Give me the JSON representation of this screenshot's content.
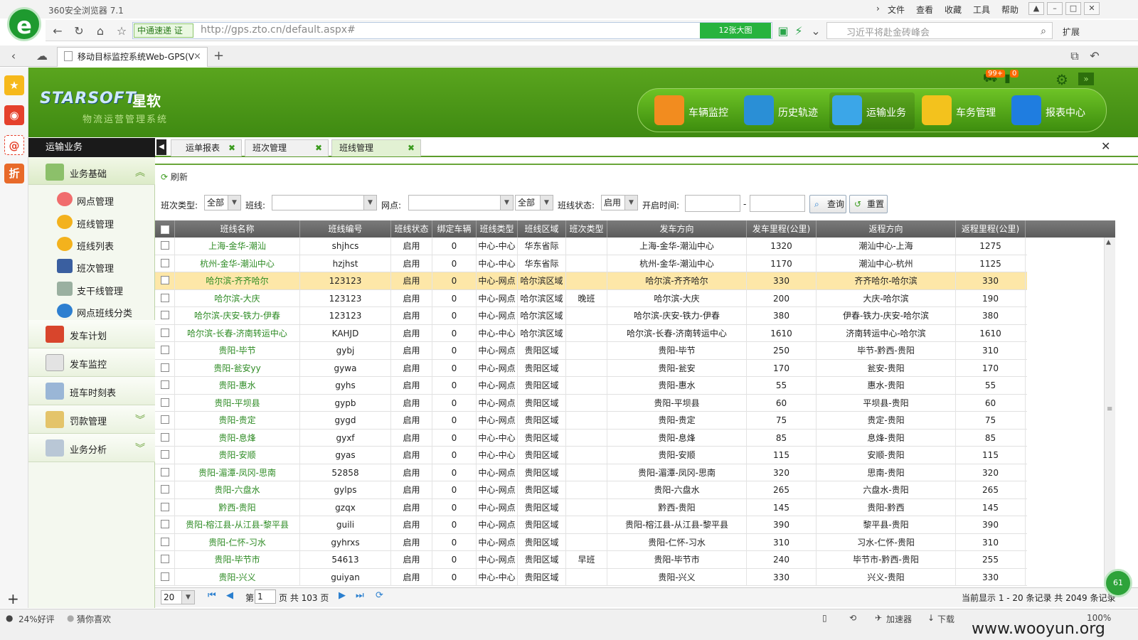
{
  "browser": {
    "title": "360安全浏览器 7.1",
    "menu": [
      "文件",
      "查看",
      "收藏",
      "工具",
      "帮助"
    ],
    "site_badge": "中通速递 证",
    "url": "http://gps.zto.cn/default.aspx#",
    "big_image": "12张大图",
    "search_placeholder": "习近平将赴金砖峰会",
    "extensions_label": "扩展",
    "tab_title": "移动目标监控系统Web-GPS(V",
    "status": {
      "rating": "24%好评",
      "guess": "猜你喜欢",
      "accelerator": "加速器",
      "download": "下载",
      "zoom": "100%"
    }
  },
  "app": {
    "brand": "STARSOFT",
    "brand_cn": "星软",
    "subtitle": "物流运营管理系统",
    "badges": [
      "99+",
      "0"
    ],
    "modules": [
      {
        "label": "车辆监控",
        "color": "#f28c1f"
      },
      {
        "label": "历史轨迹",
        "color": "#2a8fd6"
      },
      {
        "label": "运输业务",
        "color": "#3ba6e8"
      },
      {
        "label": "车务管理",
        "color": "#f3c21d"
      },
      {
        "label": "报表中心",
        "color": "#1f7de0"
      }
    ],
    "active_module": "运输业务"
  },
  "nav": {
    "header": "运输业务",
    "group_basic": "业务基础",
    "sub_items": [
      "网点管理",
      "班线管理",
      "班线列表",
      "班次管理",
      "支干线管理",
      "网点班线分类"
    ],
    "groups": [
      "发车计划",
      "发车监控",
      "班车时刻表",
      "罚款管理",
      "业务分析"
    ]
  },
  "tabs": [
    "运单报表",
    "班次管理",
    "班线管理"
  ],
  "toolbar": {
    "refresh": "刷新"
  },
  "filters": {
    "shift_type_label": "班次类型:",
    "shift_type_value": "全部",
    "line_label": "班线:",
    "line_value": "",
    "site_label": "网点:",
    "site_value": "",
    "site_scope": "全部",
    "status_label": "班线状态:",
    "status_value": "启用",
    "start_label": "开启时间:",
    "start_from": "",
    "start_to": "",
    "dash": "-",
    "query": "查询",
    "reset": "重置"
  },
  "grid": {
    "columns": [
      "班线名称",
      "班线编号",
      "班线状态",
      "绑定车辆",
      "班线类型",
      "班线区域",
      "班次类型",
      "发车方向",
      "发车里程(公里)",
      "返程方向",
      "返程里程(公里)"
    ],
    "rows": [
      [
        "上海-金华-潮汕",
        "shjhcs",
        "启用",
        "0",
        "中心-中心",
        "华东省际",
        "",
        "上海-金华-潮汕中心",
        "1320",
        "潮汕中心-上海",
        "1275"
      ],
      [
        "杭州-金华-潮汕中心",
        "hzjhst",
        "启用",
        "0",
        "中心-中心",
        "华东省际",
        "",
        "杭州-金华-潮汕中心",
        "1170",
        "潮汕中心-杭州",
        "1125"
      ],
      [
        "哈尔滨-齐齐哈尔",
        "123123",
        "启用",
        "0",
        "中心-网点",
        "哈尔滨区域",
        "",
        "哈尔滨-齐齐哈尔",
        "330",
        "齐齐哈尔-哈尔滨",
        "330"
      ],
      [
        "哈尔滨-大庆",
        "123123",
        "启用",
        "0",
        "中心-网点",
        "哈尔滨区域",
        "晚班",
        "哈尔滨-大庆",
        "200",
        "大庆-哈尔滨",
        "190"
      ],
      [
        "哈尔滨-庆安-铁力-伊春",
        "123123",
        "启用",
        "0",
        "中心-网点",
        "哈尔滨区域",
        "",
        "哈尔滨-庆安-铁力-伊春",
        "380",
        "伊春-铁力-庆安-哈尔滨",
        "380"
      ],
      [
        "哈尔滨-长春-济南转运中心",
        "KAHJD",
        "启用",
        "0",
        "中心-中心",
        "哈尔滨区域",
        "",
        "哈尔滨-长春-济南转运中心",
        "1610",
        "济南转运中心-哈尔滨",
        "1610"
      ],
      [
        "贵阳-毕节",
        "gybj",
        "启用",
        "0",
        "中心-网点",
        "贵阳区域",
        "",
        "贵阳-毕节",
        "250",
        "毕节-黔西-贵阳",
        "310"
      ],
      [
        "贵阳-瓮安yy",
        "gywa",
        "启用",
        "0",
        "中心-网点",
        "贵阳区域",
        "",
        "贵阳-瓮安",
        "170",
        "瓮安-贵阳",
        "170"
      ],
      [
        "贵阳-惠水",
        "gyhs",
        "启用",
        "0",
        "中心-网点",
        "贵阳区域",
        "",
        "贵阳-惠水",
        "55",
        "惠水-贵阳",
        "55"
      ],
      [
        "贵阳-平坝县",
        "gypb",
        "启用",
        "0",
        "中心-网点",
        "贵阳区域",
        "",
        "贵阳-平坝县",
        "60",
        "平坝县-贵阳",
        "60"
      ],
      [
        "贵阳-贵定",
        "gygd",
        "启用",
        "0",
        "中心-网点",
        "贵阳区域",
        "",
        "贵阳-贵定",
        "75",
        "贵定-贵阳",
        "75"
      ],
      [
        "贵阳-息烽",
        "gyxf",
        "启用",
        "0",
        "中心-中心",
        "贵阳区域",
        "",
        "贵阳-息烽",
        "85",
        "息烽-贵阳",
        "85"
      ],
      [
        "贵阳-安顺",
        "gyas",
        "启用",
        "0",
        "中心-中心",
        "贵阳区域",
        "",
        "贵阳-安顺",
        "115",
        "安顺-贵阳",
        "115"
      ],
      [
        "贵阳-湄潭-凤冈-思南",
        "52858",
        "启用",
        "0",
        "中心-网点",
        "贵阳区域",
        "",
        "贵阳-湄潭-凤冈-思南",
        "320",
        "思南-贵阳",
        "320"
      ],
      [
        "贵阳-六盘水",
        "gylps",
        "启用",
        "0",
        "中心-网点",
        "贵阳区域",
        "",
        "贵阳-六盘水",
        "265",
        "六盘水-贵阳",
        "265"
      ],
      [
        "黔西-贵阳",
        "gzqx",
        "启用",
        "0",
        "中心-网点",
        "贵阳区域",
        "",
        "黔西-贵阳",
        "145",
        "贵阳-黔西",
        "145"
      ],
      [
        "贵阳-榕江县-从江县-黎平县",
        "guili",
        "启用",
        "0",
        "中心-网点",
        "贵阳区域",
        "",
        "贵阳-榕江县-从江县-黎平县",
        "390",
        "黎平县-贵阳",
        "390"
      ],
      [
        "贵阳-仁怀-习水",
        "gyhrxs",
        "启用",
        "0",
        "中心-网点",
        "贵阳区域",
        "",
        "贵阳-仁怀-习水",
        "310",
        "习水-仁怀-贵阳",
        "310"
      ],
      [
        "贵阳-毕节市",
        "54613",
        "启用",
        "0",
        "中心-网点",
        "贵阳区域",
        "早班",
        "贵阳-毕节市",
        "240",
        "毕节市-黔西-贵阳",
        "255"
      ],
      [
        "贵阳-兴义",
        "guiyan",
        "启用",
        "0",
        "中心-中心",
        "贵阳区域",
        "",
        "贵阳-兴义",
        "330",
        "兴义-贵阳",
        "330"
      ]
    ],
    "selected_row": 2
  },
  "pager": {
    "page_size": "20",
    "page_prefix": "第",
    "page": "1",
    "page_suffix": "页 共 103 页",
    "summary": "当前显示 1 - 20 条记录 共 2049 条记录"
  },
  "watermark": "www.wooyun.org"
}
